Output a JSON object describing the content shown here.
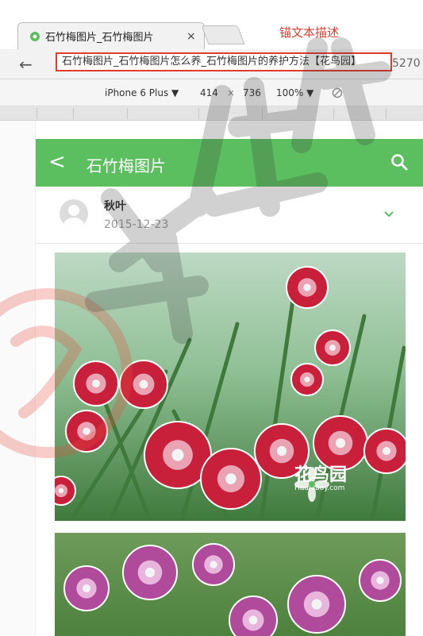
{
  "browser": {
    "tab_title": "石竹梅图片_石竹梅图片",
    "tab_close": "×",
    "url_text": "石竹梅图片_石竹梅图片怎么养_石竹梅图片的养护方法【花鸟园】",
    "url_suffix": "5270",
    "annotation": "锚文本描述",
    "back_glyph": "←"
  },
  "devtools": {
    "device": "iPhone 6 Plus ▼",
    "width": "414",
    "times": "×",
    "height": "736",
    "zoom": "100% ▼",
    "rotate_glyph": "⃠"
  },
  "page": {
    "header": {
      "back_glyph": "<",
      "title": "石竹梅图片"
    },
    "author": {
      "name": "秋叶",
      "date": "2015-12-23"
    },
    "photo_watermark": {
      "brand": "花鸟园",
      "site": "Huaniaoy.com"
    }
  },
  "colors": {
    "header_green": "#5bbf5f",
    "annotation_red": "#e23c2f"
  }
}
